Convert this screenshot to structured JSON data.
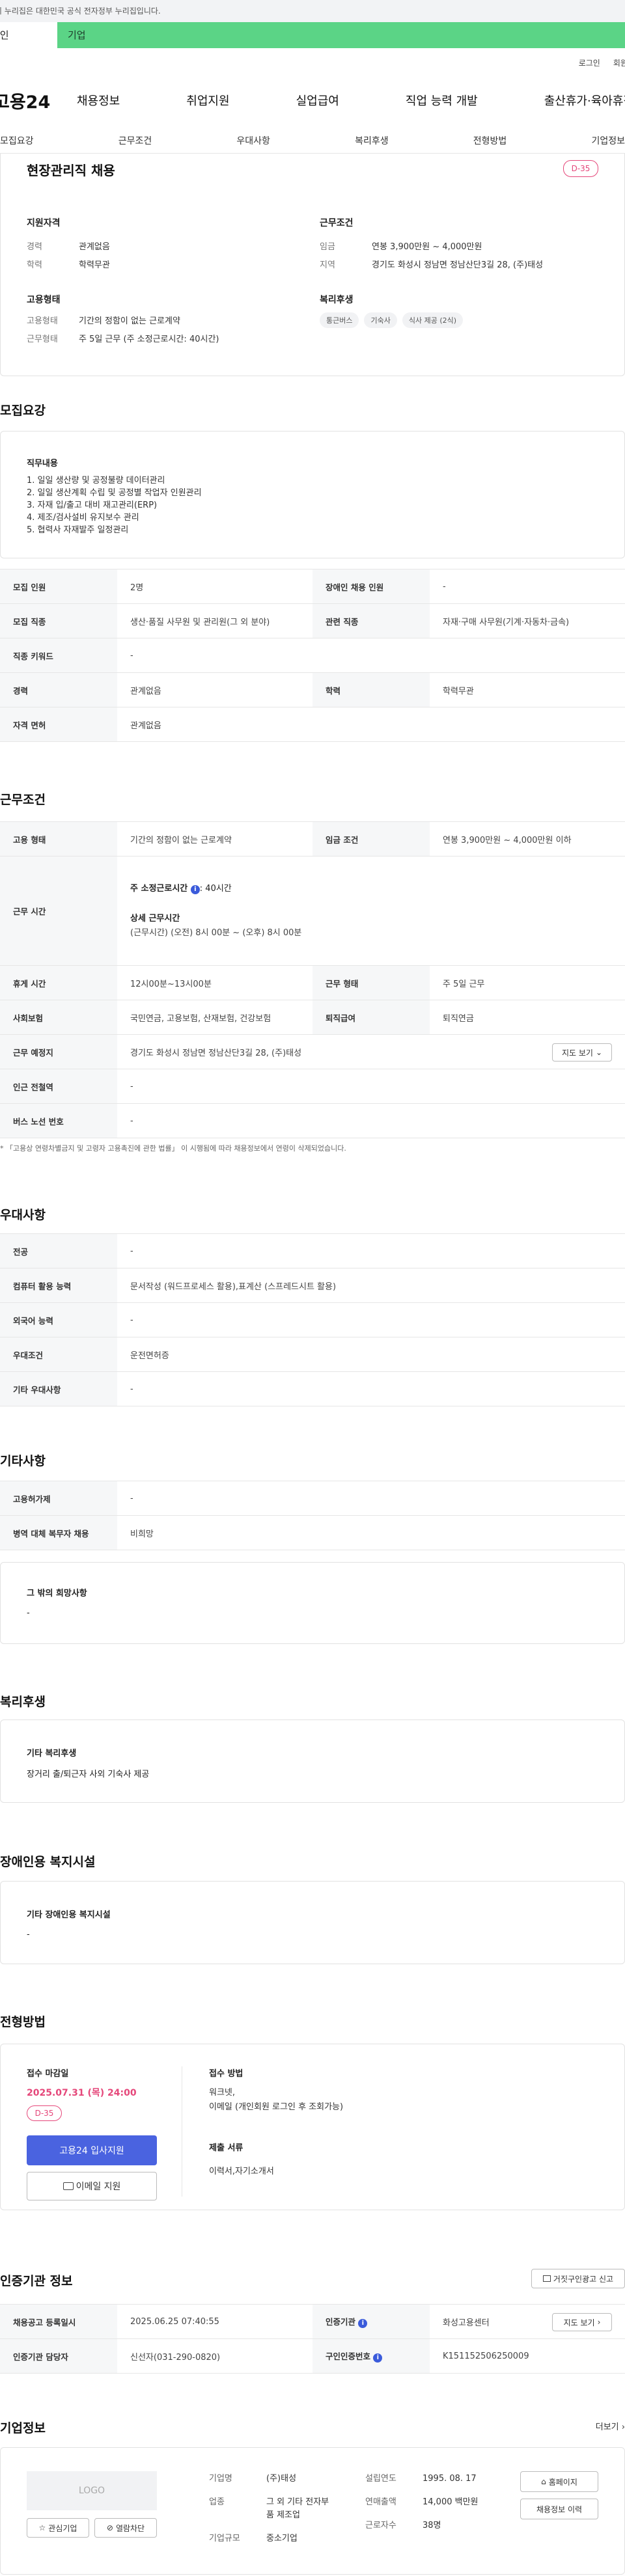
{
  "gov_bar": {
    "text": "이 누리집은 대한민국 공식 전자정부 누리집입니다."
  },
  "top_tabs": {
    "individual": "개인",
    "company": "기업"
  },
  "util": {
    "login": "로그인",
    "join": "회원가입"
  },
  "gnb": {
    "logo": "고용24",
    "menu": [
      "채용정보",
      "취업지원",
      "실업급여",
      "직업 능력 개발",
      "출산휴가·육아휴직"
    ]
  },
  "subnav": [
    "모집요강",
    "근무조건",
    "우대사항",
    "복리후생",
    "전형방법",
    "기업정보"
  ],
  "summary": {
    "title": "현장관리직 채용",
    "dday": "D-35",
    "qual_heading": "지원자격",
    "career_k": "경력",
    "career_v": "관계없음",
    "edu_k": "학력",
    "edu_v": "학력무관",
    "cond_heading": "근무조건",
    "wage_k": "임금",
    "wage_v": "연봉 3,900만원 ~ 4,000만원",
    "loc_k": "지역",
    "loc_v": "경기도 화성시 정남면 정남산단3길 28, (주)태성",
    "emp_heading": "고용형태",
    "emp_type_k": "고용형태",
    "emp_type_v": "기간의 정함이 없는 근로계약",
    "work_type_k": "근무형태",
    "work_type_v": "주 5일 근무 (주 소정근로시간: 40시간)",
    "welfare_heading": "복리후생",
    "welfare_chips": [
      "통근버스",
      "기숙사",
      "식사 제공 (2식)"
    ]
  },
  "recruit": {
    "title": "모집요강",
    "duty_heading": "직무내용",
    "duties": [
      "1. 일일 생산량 및 공정불량 데이터관리",
      "2. 일일 생산계획 수립 및 공정별 작업자 인원관리",
      "3. 자재 입/출고 대비 재고관리(ERP)",
      "4. 제조/검사설비 유지보수 관리",
      "5. 협력사 자재발주 일정관리"
    ],
    "rows": [
      {
        "k1": "모집 인원",
        "v1": "2명",
        "k2": "장애인 채용 인원",
        "v2": "-"
      },
      {
        "k1": "모집 직종",
        "v1": "생산·품질 사무원 및 관리원(그 외 분야)",
        "k2": "관련 직종",
        "v2": "자재·구매 사무원(기계·자동차·금속)"
      },
      {
        "k1": "직종 키워드",
        "v1": "-"
      },
      {
        "k1": "경력",
        "v1": "관계없음",
        "k2": "학력",
        "v2": "학력무관"
      },
      {
        "k1": "자격 면허",
        "v1": "관계없음"
      }
    ]
  },
  "work": {
    "title": "근무조건",
    "emp_k": "고용 형태",
    "emp_v": "기간의 정함이 없는 근로계약",
    "wage_k": "임금 조건",
    "wage_v": "연봉 3,900만원 ~ 4,000만원 이하",
    "hours_k": "근무 시간",
    "weekly_label": "주 소정근로시간",
    "weekly_value": ": 40시간",
    "detail_label": "상세 근무시간",
    "detail_value": "(근무시간) (오전) 8시 00분 ~ (오후) 8시 00분",
    "break_k": "휴게 시간",
    "break_v": "12시00분~13시00분",
    "shift_k": "근무 형태",
    "shift_v": "주 5일 근무",
    "ins_k": "사회보험",
    "ins_v": "국민연금, 고용보험, 산재보험, 건강보험",
    "ret_k": "퇴직급여",
    "ret_v": "퇴직연금",
    "place_k": "근무 예정지",
    "place_v": "경기도 화성시 정남면 정남산단3길 28, (주)태성",
    "map_btn": "지도 보기",
    "subway_k": "인근 전철역",
    "subway_v": "-",
    "bus_k": "버스 노선 번호",
    "bus_v": "-",
    "note": "* 「고용상 연령차별금지 및 고령자 고용촉진에 관한 법률」 이 시행됨에 따라 채용정보에서 연령이 삭제되었습니다."
  },
  "pref": {
    "title": "우대사항",
    "rows": [
      {
        "k": "전공",
        "v": "-"
      },
      {
        "k": "컴퓨터 활용 능력",
        "v": "문서작성 (워드프로세스 활용),표계산 (스프레드시트 활용)"
      },
      {
        "k": "외국어 능력",
        "v": "-"
      },
      {
        "k": "우대조건",
        "v": "운전면허증"
      },
      {
        "k": "기타 우대사항",
        "v": "-"
      }
    ]
  },
  "etc": {
    "title": "기타사항",
    "rows": [
      {
        "k": "고용허가제",
        "v": "-"
      },
      {
        "k": "병역 대체 복무자 채용",
        "v": "비희망"
      }
    ],
    "wish_heading": "그 밖의 희망사항",
    "wish_value": "-"
  },
  "welfare": {
    "title": "복리후생",
    "heading": "기타 복리후생",
    "value": "장거리 출/퇴근자 사외 기숙사 제공"
  },
  "disability": {
    "title": "장애인용 복지시설",
    "heading": "기타 장애인용 복지시설",
    "value": "-"
  },
  "process": {
    "title": "전형방법",
    "deadline_label": "접수 마감일",
    "deadline_value": "2025.07.31 (목) 24:00",
    "dday": "D-35",
    "apply_btn": "고용24 입사지원",
    "email_btn": "이메일 지원",
    "method_label": "접수 방법",
    "method_value": [
      "워크넷,",
      "이메일 (개인회원 로그인 후 조회가능)"
    ],
    "docs_label": "제출 서류",
    "docs_value": "이력서,자기소개서"
  },
  "cert": {
    "title": "인증기관 정보",
    "report_btn": "거짓구인광고 신고",
    "reg_k": "채용공고 등록일시",
    "reg_v": "2025.06.25 07:40:55",
    "org_k": "인증기관",
    "org_v": "화성고용센터",
    "view_btn": "지도 보기",
    "mgr_k": "인증기관 담당자",
    "mgr_v": "신선자(031-290-0820)",
    "num_k": "구인인증번호",
    "num_v": "K151152506250009"
  },
  "company": {
    "title": "기업정보",
    "more": "더보기",
    "logo_text": "LOGO",
    "interest_btn": "관심기업",
    "block_btn": "열람차단",
    "name_k": "기업명",
    "name_v": "(주)태성",
    "ind_k": "업종",
    "ind_v": [
      "그 외 기타 전자부",
      "품 제조업"
    ],
    "size_k": "기업규모",
    "size_v": "중소기업",
    "year_k": "설립연도",
    "year_v": "1995. 08. 17",
    "sales_k": "연매출액",
    "sales_v": "14,000 백만원",
    "emp_k": "근로자수",
    "emp_v": "38명",
    "home_btn": "홈페이지",
    "history_btn": "채용정보 이력"
  }
}
